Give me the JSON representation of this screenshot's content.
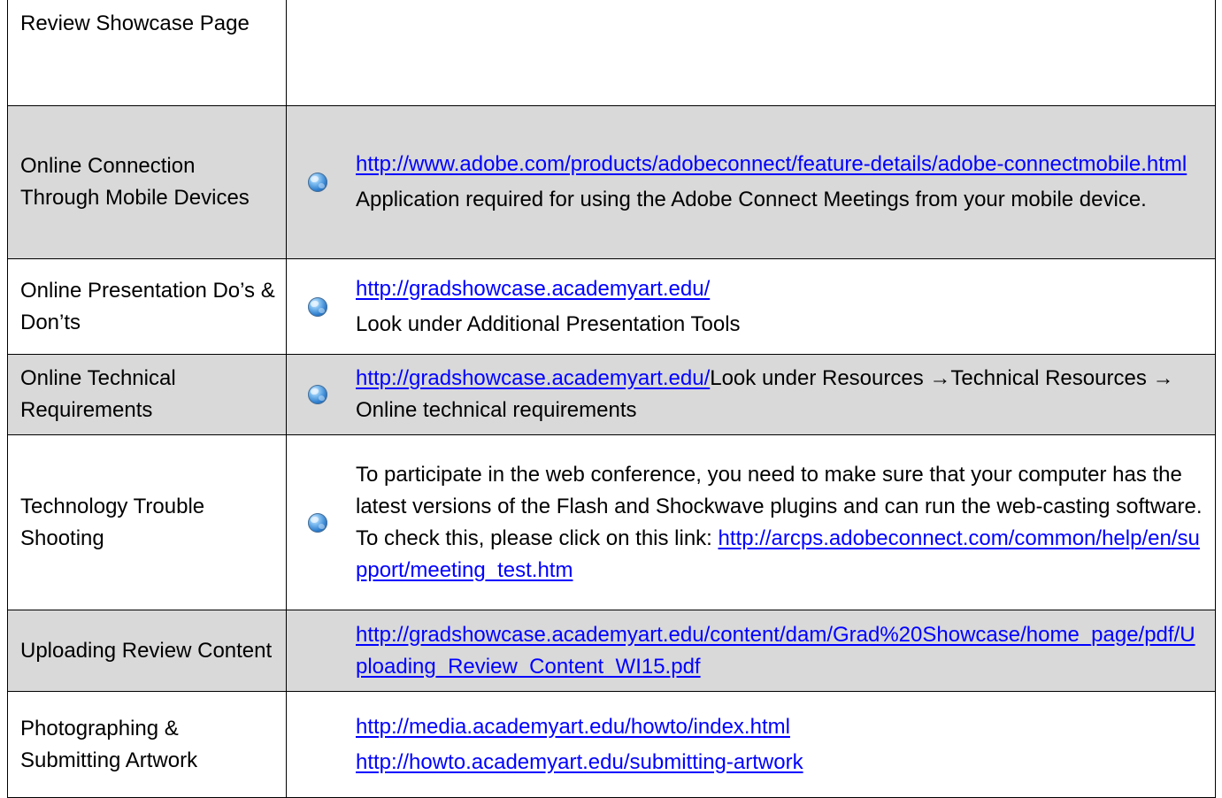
{
  "rows": [
    {
      "label": "Review Showcase Page"
    },
    {
      "label": "Online Connection Through Mobile Devices",
      "link": "http://www.adobe.com/products/adobeconnect/feature-details/adobe-connectmobile.html",
      "desc": "Application required for using the Adobe Connect Meetings from your mobile device."
    },
    {
      "label": "Online Presentation Do’s & Don’ts",
      "link": "http://gradshowcase.academyart.edu/",
      "desc": "Look under Additional Presentation Tools"
    },
    {
      "label": "Online Technical Requirements",
      "link": "http://gradshowcase.academyart.edu/",
      "desc": "Look under Resources →Technical Resources → Online technical requirements"
    },
    {
      "label": "Technology Trouble Shooting",
      "desc": "To participate in the web conference, you need to make sure that your computer has the latest versions of the Flash and Shockwave plugins and can run the web-casting software.  To check this, please click on this link: ",
      "link": "http://arcps.adobeconnect.com/common/help/en/support/meeting_test.htm"
    },
    {
      "label": "Uploading Review Content",
      "link": "http://gradshowcase.academyart.edu/content/dam/Grad%20Showcase/home_page/pdf/Uploading_Review_Content_WI15.pdf"
    },
    {
      "label": "Photographing & Submitting Artwork",
      "link": "http://media.academyart.edu/howto/index.html",
      "link2": "http://howto.academyart.edu/submitting-artwork"
    }
  ],
  "colors": {
    "shade": "#d9d9d9",
    "link": "#0000ff",
    "border": "#000000"
  },
  "icons": {
    "bullet": "globe-icon"
  }
}
